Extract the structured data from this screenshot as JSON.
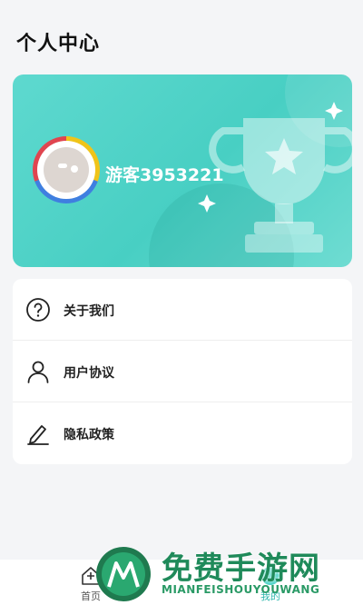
{
  "page": {
    "title": "个人中心"
  },
  "profile": {
    "username": "游客3953221"
  },
  "menu": {
    "items": [
      {
        "label": "关于我们",
        "icon": "help-circle-icon"
      },
      {
        "label": "用户协议",
        "icon": "user-icon"
      },
      {
        "label": "隐私政策",
        "icon": "edit-pen-icon"
      }
    ]
  },
  "tabbar": {
    "tabs": [
      {
        "label": "首页",
        "icon": "home-icon"
      },
      {
        "label": "我的",
        "icon": "profile-icon"
      }
    ]
  },
  "watermark": {
    "title": "免费手游网",
    "subtitle": "MIANFEISHOUYOUWANG"
  },
  "colors": {
    "accent": "#4fd3c8",
    "background": "#f4f5f7",
    "watermark": "#1f8a5a"
  }
}
